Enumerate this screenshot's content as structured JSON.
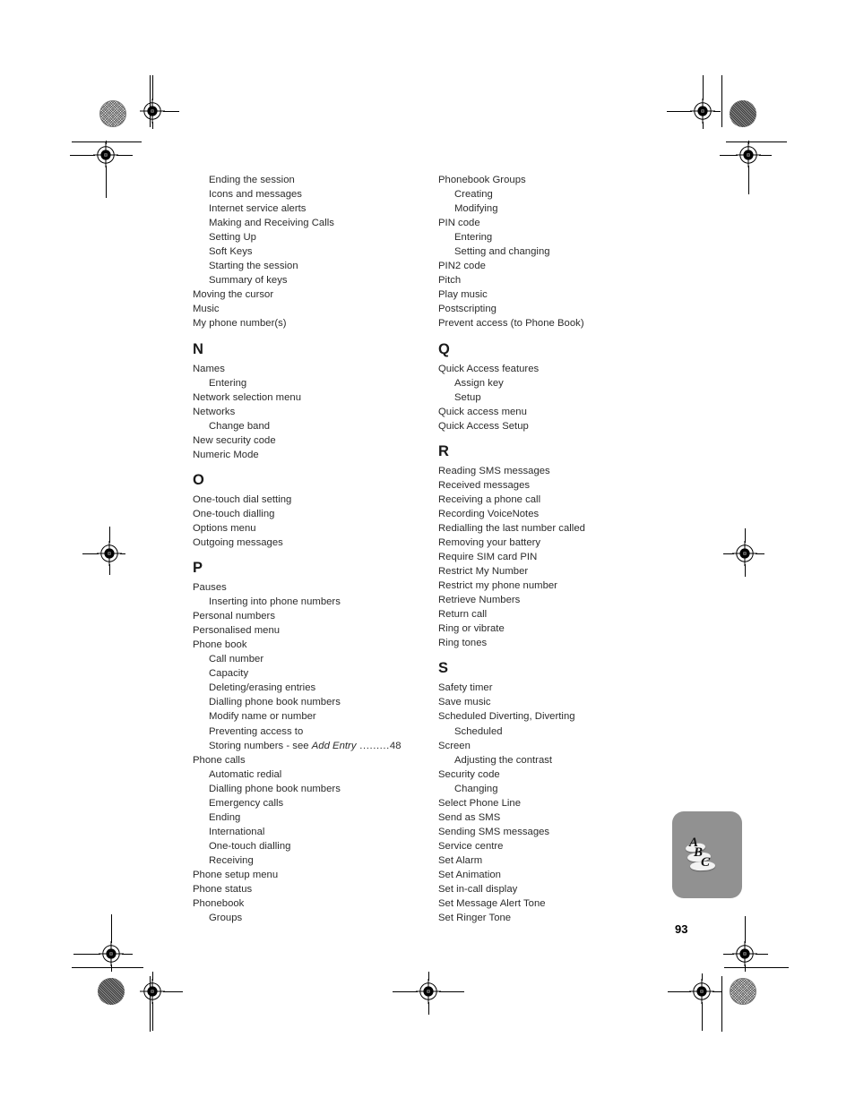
{
  "document": {
    "type": "printed-index-page",
    "page_number": "93",
    "thumb_tab": {
      "label": "ABC",
      "letters": [
        "A",
        "B",
        "C"
      ],
      "background_color": "#919191"
    }
  },
  "columns": {
    "left": [
      {
        "kind": "entry",
        "level": 2,
        "text": "Ending the session"
      },
      {
        "kind": "entry",
        "level": 2,
        "text": "Icons and messages"
      },
      {
        "kind": "entry",
        "level": 2,
        "text": "Internet service alerts"
      },
      {
        "kind": "entry",
        "level": 2,
        "text": "Making and Receiving Calls"
      },
      {
        "kind": "entry",
        "level": 2,
        "text": "Setting Up"
      },
      {
        "kind": "entry",
        "level": 2,
        "text": "Soft Keys"
      },
      {
        "kind": "entry",
        "level": 2,
        "text": "Starting the session"
      },
      {
        "kind": "entry",
        "level": 2,
        "text": "Summary of keys"
      },
      {
        "kind": "entry",
        "level": 1,
        "text": "Moving the cursor"
      },
      {
        "kind": "entry",
        "level": 1,
        "text": "Music"
      },
      {
        "kind": "entry",
        "level": 1,
        "text": "My phone number(s)"
      },
      {
        "kind": "letter",
        "text": "N"
      },
      {
        "kind": "entry",
        "level": 1,
        "text": "Names"
      },
      {
        "kind": "entry",
        "level": 2,
        "text": "Entering"
      },
      {
        "kind": "entry",
        "level": 1,
        "text": "Network selection menu"
      },
      {
        "kind": "entry",
        "level": 1,
        "text": "Networks"
      },
      {
        "kind": "entry",
        "level": 2,
        "text": "Change band"
      },
      {
        "kind": "entry",
        "level": 1,
        "text": "New security code"
      },
      {
        "kind": "entry",
        "level": 1,
        "text": "Numeric Mode"
      },
      {
        "kind": "letter",
        "text": "O"
      },
      {
        "kind": "entry",
        "level": 1,
        "text": "One-touch dial setting"
      },
      {
        "kind": "entry",
        "level": 1,
        "text": "One-touch dialling"
      },
      {
        "kind": "entry",
        "level": 1,
        "text": "Options menu"
      },
      {
        "kind": "entry",
        "level": 1,
        "text": "Outgoing messages"
      },
      {
        "kind": "letter",
        "text": "P"
      },
      {
        "kind": "entry",
        "level": 1,
        "text": "Pauses"
      },
      {
        "kind": "entry",
        "level": 2,
        "text": "Inserting into phone numbers"
      },
      {
        "kind": "entry",
        "level": 1,
        "text": "Personal numbers"
      },
      {
        "kind": "entry",
        "level": 1,
        "text": "Personalised menu"
      },
      {
        "kind": "entry",
        "level": 1,
        "text": "Phone book"
      },
      {
        "kind": "entry",
        "level": 2,
        "text": "Call number"
      },
      {
        "kind": "entry",
        "level": 2,
        "text": "Capacity"
      },
      {
        "kind": "entry",
        "level": 2,
        "text": "Deleting/erasing entries"
      },
      {
        "kind": "entry",
        "level": 2,
        "text": "Dialling phone book numbers"
      },
      {
        "kind": "entry",
        "level": 2,
        "text": "Modify name or number"
      },
      {
        "kind": "entry",
        "level": 2,
        "text": "Preventing access to"
      },
      {
        "kind": "entry-ref",
        "level": 2,
        "text": "Storing numbers - see ",
        "italic": "Add Entry",
        "leader": "  .........",
        "page": "48"
      },
      {
        "kind": "entry",
        "level": 1,
        "text": "Phone calls"
      },
      {
        "kind": "entry",
        "level": 2,
        "text": "Automatic redial"
      },
      {
        "kind": "entry",
        "level": 2,
        "text": "Dialling phone book numbers"
      },
      {
        "kind": "entry",
        "level": 2,
        "text": "Emergency calls"
      },
      {
        "kind": "entry",
        "level": 2,
        "text": "Ending"
      },
      {
        "kind": "entry",
        "level": 2,
        "text": "International"
      },
      {
        "kind": "entry",
        "level": 2,
        "text": "One-touch dialling"
      },
      {
        "kind": "entry",
        "level": 2,
        "text": "Receiving"
      },
      {
        "kind": "entry",
        "level": 1,
        "text": "Phone setup menu"
      },
      {
        "kind": "entry",
        "level": 1,
        "text": "Phone status"
      },
      {
        "kind": "entry",
        "level": 1,
        "text": "Phonebook"
      },
      {
        "kind": "entry",
        "level": 2,
        "text": "Groups"
      }
    ],
    "right": [
      {
        "kind": "entry",
        "level": 1,
        "text": "Phonebook Groups"
      },
      {
        "kind": "entry",
        "level": 2,
        "text": "Creating"
      },
      {
        "kind": "entry",
        "level": 2,
        "text": "Modifying"
      },
      {
        "kind": "entry",
        "level": 1,
        "text": "PIN code"
      },
      {
        "kind": "entry",
        "level": 2,
        "text": "Entering"
      },
      {
        "kind": "entry",
        "level": 2,
        "text": "Setting and changing"
      },
      {
        "kind": "entry",
        "level": 1,
        "text": "PIN2 code"
      },
      {
        "kind": "entry",
        "level": 1,
        "text": "Pitch"
      },
      {
        "kind": "entry",
        "level": 1,
        "text": "Play music"
      },
      {
        "kind": "entry",
        "level": 1,
        "text": "Postscripting"
      },
      {
        "kind": "entry",
        "level": 1,
        "text": "Prevent access (to Phone Book)"
      },
      {
        "kind": "letter",
        "text": "Q"
      },
      {
        "kind": "entry",
        "level": 1,
        "text": "Quick Access features"
      },
      {
        "kind": "entry",
        "level": 2,
        "text": "Assign key"
      },
      {
        "kind": "entry",
        "level": 2,
        "text": "Setup"
      },
      {
        "kind": "entry",
        "level": 1,
        "text": "Quick access menu"
      },
      {
        "kind": "entry",
        "level": 1,
        "text": "Quick Access Setup"
      },
      {
        "kind": "letter",
        "text": "R"
      },
      {
        "kind": "entry",
        "level": 1,
        "text": "Reading SMS messages"
      },
      {
        "kind": "entry",
        "level": 1,
        "text": "Received messages"
      },
      {
        "kind": "entry",
        "level": 1,
        "text": "Receiving a phone call"
      },
      {
        "kind": "entry",
        "level": 1,
        "text": "Recording VoiceNotes"
      },
      {
        "kind": "entry",
        "level": 1,
        "text": "Redialling the last number called"
      },
      {
        "kind": "entry",
        "level": 1,
        "text": "Removing your battery"
      },
      {
        "kind": "entry",
        "level": 1,
        "text": "Require SIM card PIN"
      },
      {
        "kind": "entry",
        "level": 1,
        "text": "Restrict My Number"
      },
      {
        "kind": "entry",
        "level": 1,
        "text": "Restrict my phone number"
      },
      {
        "kind": "entry",
        "level": 1,
        "text": "Retrieve Numbers"
      },
      {
        "kind": "entry",
        "level": 1,
        "text": "Return call"
      },
      {
        "kind": "entry",
        "level": 1,
        "text": "Ring or vibrate"
      },
      {
        "kind": "entry",
        "level": 1,
        "text": "Ring tones"
      },
      {
        "kind": "letter",
        "text": "S"
      },
      {
        "kind": "entry",
        "level": 1,
        "text": "Safety timer"
      },
      {
        "kind": "entry",
        "level": 1,
        "text": "Save music"
      },
      {
        "kind": "entry",
        "level": 1,
        "text": "Scheduled Diverting, Diverting"
      },
      {
        "kind": "entry",
        "level": 2,
        "text": "Scheduled"
      },
      {
        "kind": "entry",
        "level": 1,
        "text": "Screen"
      },
      {
        "kind": "entry",
        "level": 2,
        "text": "Adjusting the contrast"
      },
      {
        "kind": "entry",
        "level": 1,
        "text": "Security code"
      },
      {
        "kind": "entry",
        "level": 2,
        "text": "Changing"
      },
      {
        "kind": "entry",
        "level": 1,
        "text": "Select Phone Line"
      },
      {
        "kind": "entry",
        "level": 1,
        "text": "Send as SMS"
      },
      {
        "kind": "entry",
        "level": 1,
        "text": "Sending SMS messages"
      },
      {
        "kind": "entry",
        "level": 1,
        "text": "Service centre"
      },
      {
        "kind": "entry",
        "level": 1,
        "text": "Set Alarm"
      },
      {
        "kind": "entry",
        "level": 1,
        "text": "Set Animation"
      },
      {
        "kind": "entry",
        "level": 1,
        "text": "Set in-call display"
      },
      {
        "kind": "entry",
        "level": 1,
        "text": "Set Message Alert Tone"
      },
      {
        "kind": "entry",
        "level": 1,
        "text": "Set Ringer Tone"
      }
    ]
  },
  "printer_marks": {
    "registration_targets": 8,
    "density_dots": [
      {
        "position": "top-left",
        "style": "halftone-light"
      },
      {
        "position": "top-right",
        "style": "solid-dark"
      },
      {
        "position": "bottom-left",
        "style": "solid-dark"
      },
      {
        "position": "bottom-right",
        "style": "halftone-light"
      }
    ]
  }
}
